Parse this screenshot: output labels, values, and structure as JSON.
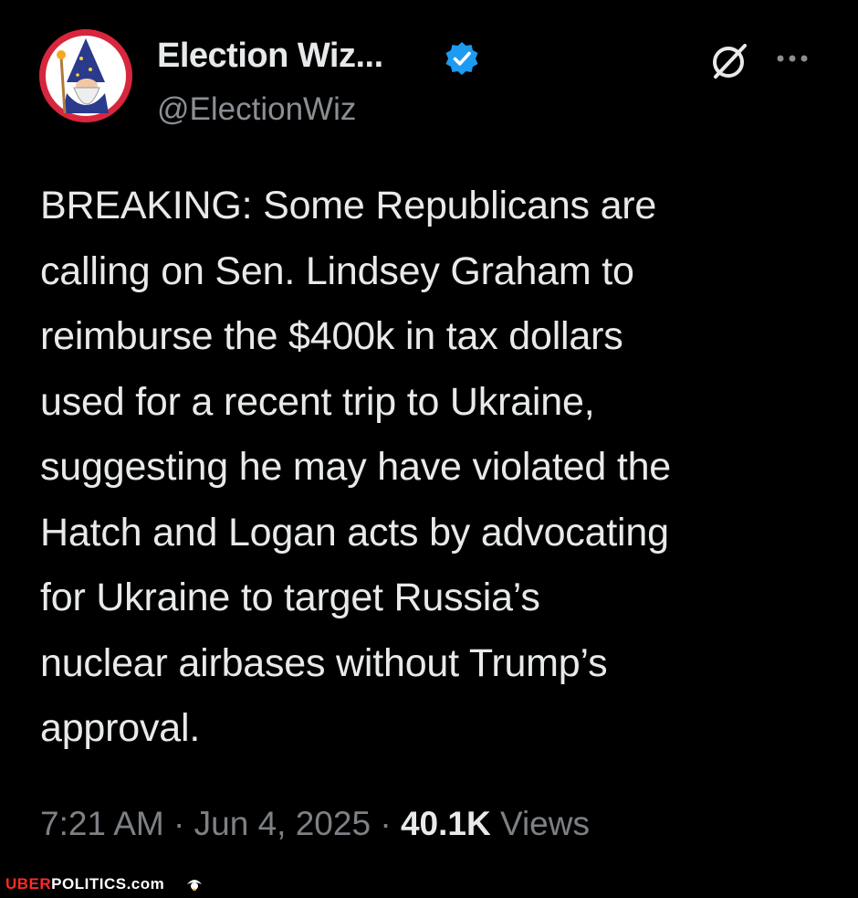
{
  "tweet": {
    "display_name": "Election Wiz...",
    "handle": "@ElectionWiz",
    "verified": true,
    "accent_color": "#1d9bf0",
    "avatar_color": "#d7263d",
    "text": "BREAKING: Some Republicans are\ncalling on Sen. Lindsey Graham to\nreimburse the $400k in tax dollars\nused for a recent trip to Ukraine,\nsuggesting he may have violated the\nHatch and Logan acts by advocating\nfor Ukraine to target Russia’s\nnuclear airbases without Trump’s\napproval.",
    "time": "7:21 AM",
    "separator": "·",
    "date": "Jun 4, 2025",
    "views_count": "40.1K",
    "views_label": "Views"
  },
  "icons": {
    "grok": "grok-icon",
    "more": "more-options-icon",
    "verified": "verified-badge-icon"
  },
  "watermark": {
    "part1": "UBER",
    "part2": "POLITICS.com"
  }
}
